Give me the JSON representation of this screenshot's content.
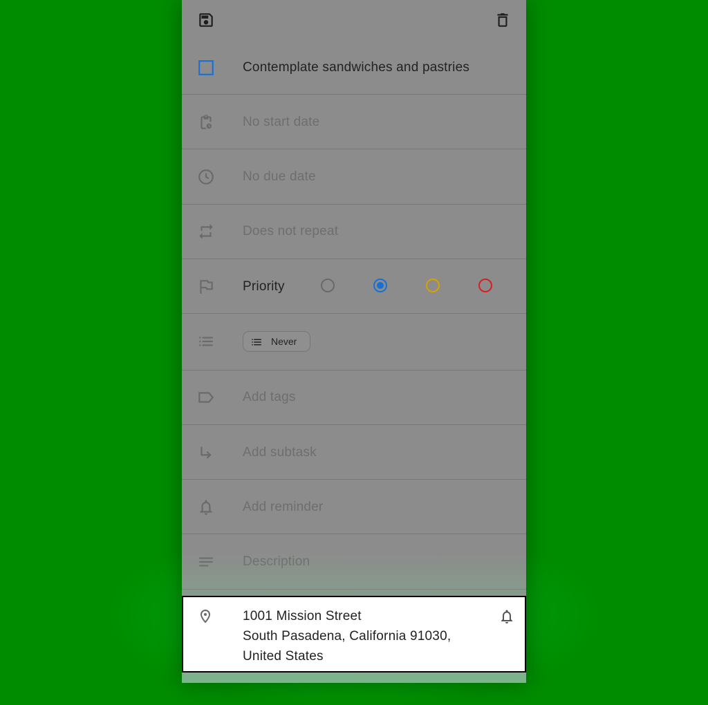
{
  "task": {
    "title": "Contemplate sandwiches and pastries"
  },
  "rows": {
    "start_date": "No start date",
    "due_date": "No due date",
    "repeat": "Does not repeat",
    "priority_label": "Priority",
    "list_chip": "Never",
    "tags": "Add tags",
    "subtask": "Add subtask",
    "reminder": "Add reminder",
    "description": "Description"
  },
  "priority": {
    "selected": "blue",
    "colors": {
      "none": "#6a6a6a",
      "blue": "#1a6fd4",
      "amber": "#d9a000",
      "red": "#d42020"
    }
  },
  "location": {
    "line1": "1001 Mission Street",
    "line2": "South Pasadena, California 91030,",
    "line3": "United States"
  },
  "icons": {
    "save": "save-icon",
    "delete": "delete-icon",
    "checkbox": "checkbox-icon",
    "start": "clipboard-clock-icon",
    "due": "clock-icon",
    "repeat": "repeat-icon",
    "priority": "flag-icon",
    "list": "list-icon",
    "tags": "tag-icon",
    "subtask": "subdirectory-arrow-icon",
    "reminder": "bell-icon",
    "description": "notes-icon",
    "location": "location-pin-icon",
    "location_alert": "bell-outline-icon"
  }
}
